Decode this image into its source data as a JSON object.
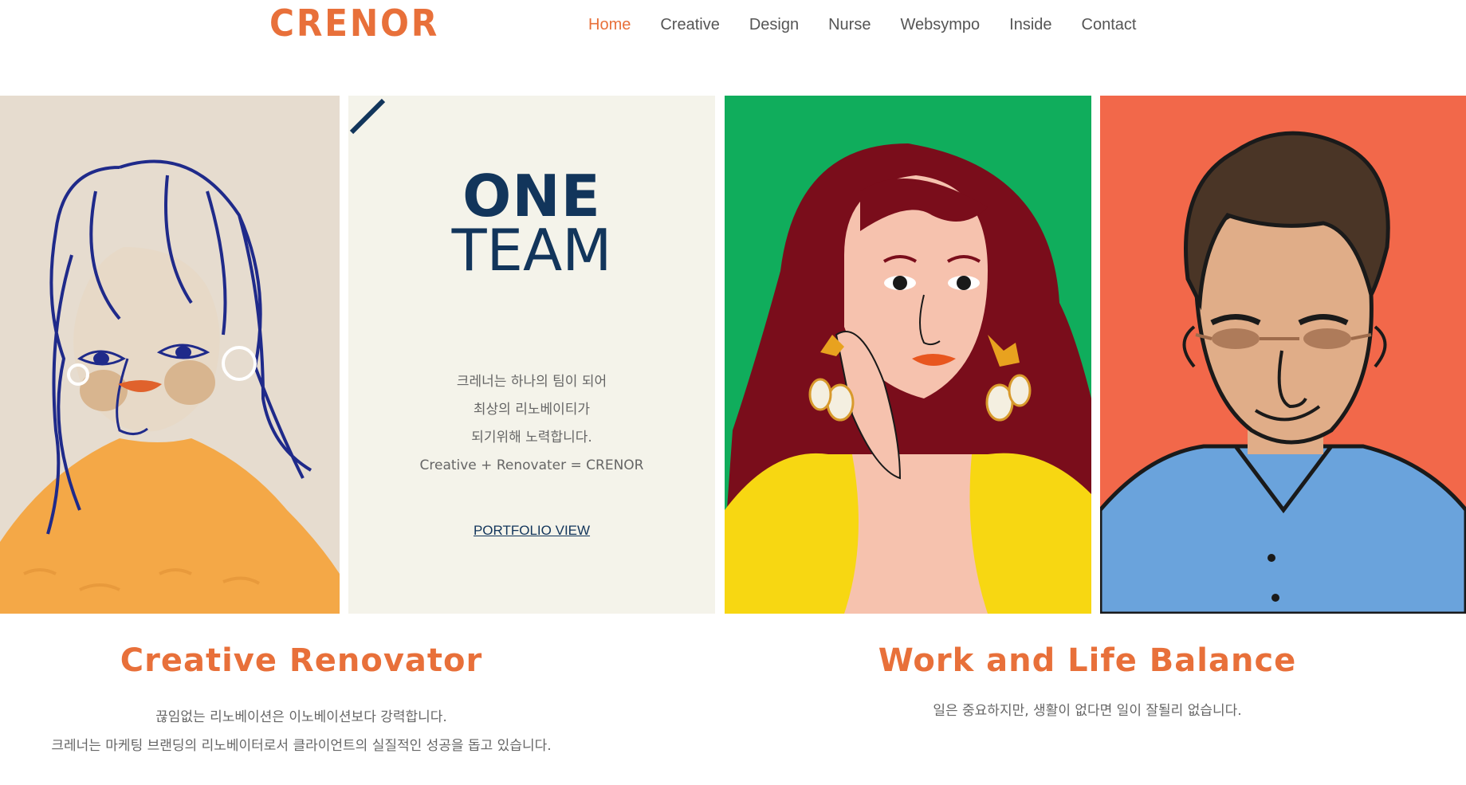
{
  "header": {
    "logo": "CRENOR",
    "nav": [
      "Home",
      "Creative",
      "Design",
      "Nurse",
      "Websympo",
      "Inside",
      "Contact"
    ],
    "active": "Home"
  },
  "hero": {
    "title_line1": "ONE",
    "title_line2": "TEAM",
    "description": [
      "크레너는 하나의 팀이 되어",
      "최상의 리노베이티가",
      "되기위해 노력합니다.",
      "Creative + Renovater = CRENOR"
    ],
    "cta": "PORTFOLIO VIEW"
  },
  "sections": [
    {
      "title": "Creative Renovator",
      "lines": [
        "끊임없는 리노베이션은 이노베이션보다 강력합니다.",
        "크레너는 마케팅 브랜딩의 리노베이터로서 클라이언트의 실질적인 성공을 돕고 있습니다."
      ]
    },
    {
      "title": "Work and Life Balance",
      "lines": [
        "일은 중요하지만, 생활이 없다면 일이 잘될리 없습니다."
      ]
    }
  ],
  "colors": {
    "accent": "#e8703a",
    "navy": "#12355b",
    "green_panel": "#10ad5c",
    "coral_panel": "#f2684a",
    "cream_panel": "#f4f3ea",
    "beige_panel": "#e6dccf"
  },
  "illustrations": [
    "woman-blue-line-portrait",
    "woman-earrings-portrait",
    "man-glasses-portrait"
  ]
}
